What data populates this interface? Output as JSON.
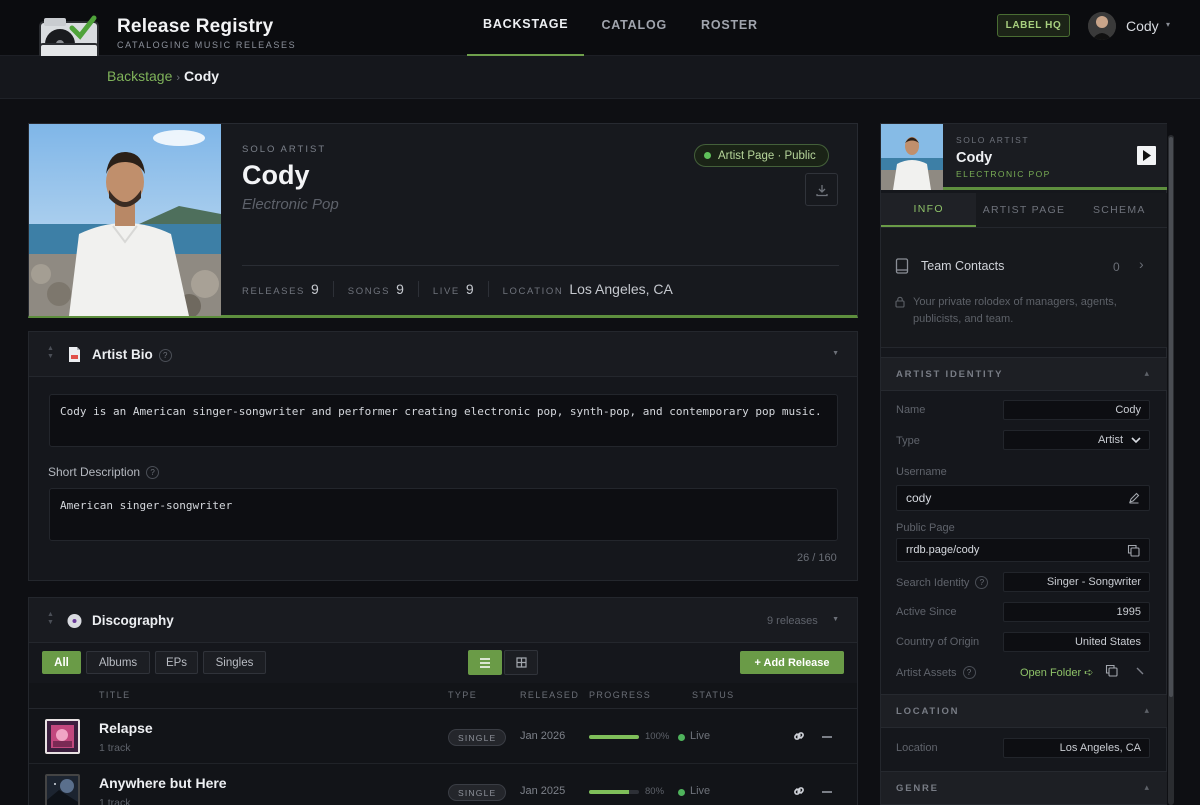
{
  "app": {
    "title": "Release Registry",
    "subtitle": "CATALOGING MUSIC RELEASES",
    "nav": [
      "BACKSTAGE",
      "CATALOG",
      "ROSTER"
    ],
    "label_button": "LABEL HQ",
    "user_name": "Cody",
    "user_caret": "▾"
  },
  "breadcrumb": {
    "parent": "Backstage",
    "separator": "›",
    "current": "Cody"
  },
  "hero": {
    "type": "SOLO ARTIST",
    "name": "Cody",
    "genre": "Electronic Pop",
    "status": "Artist Page · Public",
    "stats": [
      {
        "label": "RELEASES",
        "value": "9"
      },
      {
        "label": "SONGS",
        "value": "9"
      },
      {
        "label": "LIVE",
        "value": "9"
      },
      {
        "label": "LOCATION",
        "value": "Los Angeles, CA"
      }
    ]
  },
  "bio": {
    "title": "Artist Bio",
    "help": "?",
    "text": "Cody is an American singer-songwriter and performer creating electronic pop, synth-pop, and contemporary pop music.",
    "short_label": "Short Description",
    "short_text": "American singer-songwriter",
    "counter": "26 / 160"
  },
  "discography": {
    "title": "Discography",
    "count": "9 releases",
    "filters": [
      "All",
      "Albums",
      "EPs",
      "Singles"
    ],
    "add_label": "+ Add Release",
    "columns": [
      "TITLE",
      "TYPE",
      "RELEASED",
      "PROGRESS",
      "STATUS"
    ],
    "rows": [
      {
        "title": "Relapse",
        "sub": "1 track",
        "type": "SINGLE",
        "date": "Jan 2026",
        "progress": 100,
        "progress_label": "100%",
        "status": "Live"
      },
      {
        "title": "Anywhere but Here",
        "sub": "1 track",
        "type": "SINGLE",
        "date": "Jan 2025",
        "progress": 80,
        "progress_label": "80%",
        "status": "Live"
      }
    ]
  },
  "sidebar": {
    "type": "SOLO ARTIST",
    "name": "Cody",
    "genre": "ELECTRONIC POP",
    "tabs": [
      "INFO",
      "ARTIST PAGE",
      "SCHEMA"
    ],
    "contacts_title": "Team Contacts",
    "contacts_count": "0",
    "contacts_note": "Your private rolodex of managers, agents, publicists, and team.",
    "identity_title": "ARTIST IDENTITY",
    "fields": {
      "name_label": "Name",
      "name": "Cody",
      "type_label": "Type",
      "type": "Artist",
      "username_label": "Username",
      "username": "cody",
      "public_label": "Public Page",
      "public": "rrdb.page/cody",
      "search_label": "Search Identity",
      "search": "Singer - Songwriter",
      "active_label": "Active Since",
      "active": "1995",
      "country_label": "Country of Origin",
      "country": "United States",
      "assets_label": "Artist Assets",
      "assets_link": "Open Folder ➪"
    },
    "location_title": "LOCATION",
    "location_label": "Location",
    "location": "Los Angeles, CA",
    "genre_title": "GENRE"
  },
  "colors": {
    "accent": "#6a9b47",
    "accent_text": "#8ec268",
    "live": "#4fb35c",
    "background": "#0e0f13"
  }
}
